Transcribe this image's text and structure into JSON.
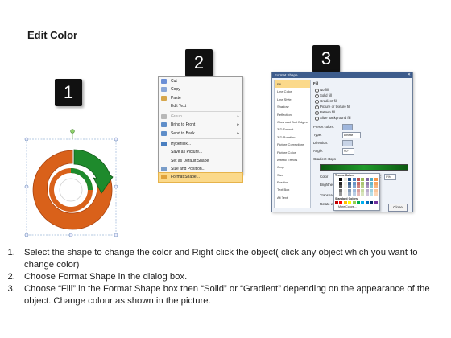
{
  "title": "Edit Color",
  "badges": [
    "1",
    "2",
    "3"
  ],
  "context_menu": {
    "items": [
      {
        "label": "Cut",
        "color": "#6b8fd6",
        "disabled": false,
        "submenu": false
      },
      {
        "label": "Copy",
        "color": "#8aa7d8",
        "disabled": false,
        "submenu": false
      },
      {
        "label": "Paste",
        "color": "#d6a64b",
        "disabled": false,
        "submenu": false
      },
      {
        "label": "Edit Text",
        "color": "",
        "disabled": false,
        "submenu": false
      },
      {
        "sep": true
      },
      {
        "label": "Group",
        "color": "#b8b8b8",
        "disabled": true,
        "submenu": true
      },
      {
        "label": "Bring to Front",
        "color": "#5f8ec9",
        "disabled": false,
        "submenu": true
      },
      {
        "label": "Send to Back",
        "color": "#5f8ec9",
        "disabled": false,
        "submenu": true
      },
      {
        "sep": true
      },
      {
        "label": "Hyperlink...",
        "color": "#4a7fc0",
        "disabled": false,
        "submenu": false
      },
      {
        "label": "Save as Picture...",
        "color": "",
        "disabled": false,
        "submenu": false
      },
      {
        "label": "Set as Default Shape",
        "color": "",
        "disabled": false,
        "submenu": false
      },
      {
        "label": "Size and Position...",
        "color": "#7a9dc9",
        "disabled": false,
        "submenu": false
      },
      {
        "label": "Format Shape...",
        "color": "#e0a23b",
        "disabled": false,
        "submenu": false,
        "highlighted": true
      }
    ]
  },
  "dialog": {
    "title": "Format Shape",
    "categories": [
      "Fill",
      "Line Color",
      "Line Style",
      "Shadow",
      "Reflection",
      "Glow and Soft Edges",
      "3-D Format",
      "3-D Rotation",
      "Picture Corrections",
      "Picture Color",
      "Artistic Effects",
      "Crop",
      "Size",
      "Position",
      "Text Box",
      "Alt Text"
    ],
    "selected_category": "Fill",
    "section_title": "Fill",
    "fill_options": [
      "No fill",
      "Solid fill",
      "Gradient fill",
      "Picture or texture fill",
      "Pattern fill",
      "Slide background fill"
    ],
    "selected_fill": "Gradient fill",
    "preset_label": "Preset colors:",
    "type_label": "Type:",
    "type_value": "Linear",
    "direction_label": "Direction:",
    "angle_label": "Angle:",
    "angle_value": "90°",
    "stops_label": "Gradient stops",
    "color_label": "Color",
    "position_label": "Position:",
    "position_value": "0%",
    "brightness_label": "Brightness:",
    "transparency_label": "Transparency:",
    "rotate_label": "Rotate with shape",
    "theme_colors_label": "Theme Colors",
    "standard_colors_label": "Standard Colors",
    "more_colors_label": "More Colors...",
    "close_label": "Close"
  },
  "instructions": [
    "Select the shape to change the color and Right click the object( click any object which you want to change color)",
    "Choose Format Shape in the dialog box.",
    "Choose “Fill” in the Format Shape box then “Solid” or “Gradient” depending on the appearance of the object. Change colour as shown in the picture."
  ],
  "colors": {
    "orange": "#d9611a",
    "green": "#1e8a2c",
    "badge": "#111111"
  }
}
